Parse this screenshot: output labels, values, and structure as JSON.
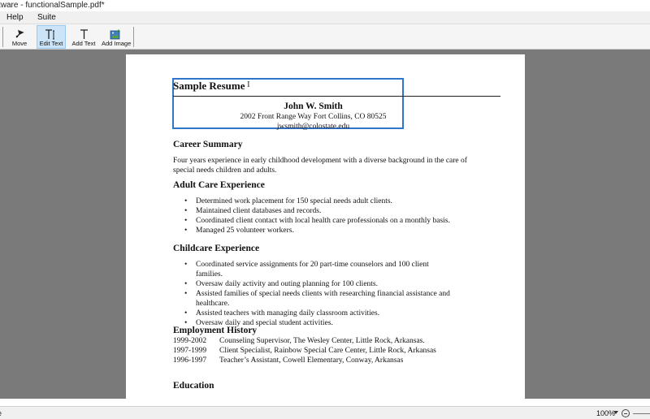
{
  "window": {
    "title": "tware - functionalSample.pdf*"
  },
  "menu": {
    "items": [
      "Help",
      "Suite"
    ]
  },
  "toolbar": {
    "buttons": [
      {
        "label": "Move",
        "icon": "move-icon"
      },
      {
        "label": "Edit Text",
        "icon": "edit-text-icon",
        "active": true
      },
      {
        "label": "Add Text",
        "icon": "add-text-icon"
      },
      {
        "label": "Add Image",
        "icon": "add-image-icon"
      }
    ],
    "active_color": "#cce4f7"
  },
  "document": {
    "title": "Sample Resume",
    "name": "John W. Smith",
    "address": "2002 Front Range Way Fort Collins, CO 80525",
    "email": "jwsmith@colostate.edu",
    "selection_color": "#2f75c9",
    "career_summary": {
      "heading": "Career Summary",
      "text_line1": "Four years experience in early childhood development with a diverse background in the care of",
      "text_line2": "special needs children and adults."
    },
    "adult_care": {
      "heading": "Adult Care Experience",
      "items": [
        "Determined work placement for 150 special needs adult clients.",
        "Maintained client databases and records.",
        "Coordinated client contact with local health care professionals on a monthly basis.",
        "Managed 25 volunteer workers."
      ]
    },
    "childcare": {
      "heading": "Childcare Experience",
      "items": [
        "Coordinated service assignments for 20 part-time counselors and 100 client families.",
        "Oversaw daily activity and outing planning for 100 clients.",
        "Assisted families of special needs clients with researching financial assistance and healthcare.",
        "Assisted teachers with managing daily classroom activities.",
        "Oversaw daily and special student activities."
      ]
    },
    "employment": {
      "heading": "Employment History",
      "rows": [
        {
          "years": "1999-2002",
          "desc": "Counseling Supervisor, The Wesley Center, Little Rock, Arkansas."
        },
        {
          "years": "1997-1999",
          "desc": "Client Specialist, Rainbow Special Care Center, Little Rock, Arkansas"
        },
        {
          "years": "1996-1997",
          "desc": "Teacher’s Assistant, Cowell Elementary, Conway, Arkansas"
        }
      ]
    },
    "education": {
      "heading": "Education"
    }
  },
  "statusbar": {
    "left_text": "e",
    "zoom": "100%"
  }
}
